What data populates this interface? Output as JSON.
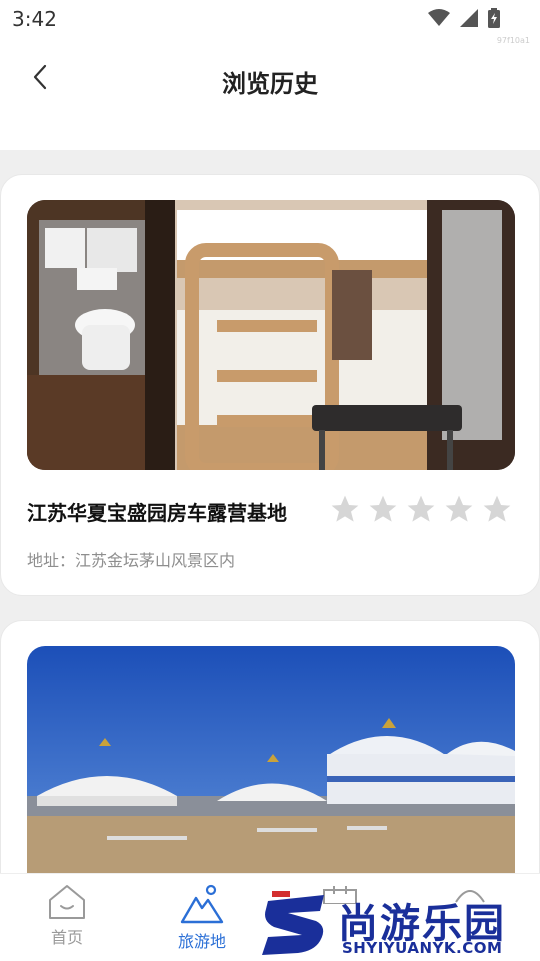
{
  "status_bar": {
    "time": "3:42",
    "watermark_id": "97f10a1"
  },
  "header": {
    "title": "浏览历史"
  },
  "cards": [
    {
      "title": "江苏华夏宝盛园房车露营基地",
      "address": "地址：江苏金坛茅山风景区内",
      "rating": {
        "stars_filled": 0,
        "stars_total": 5
      },
      "image_desc": "rv-interior-bunk-beds-photo"
    },
    {
      "image_desc": "mongolian-yurt-camp-photo"
    }
  ],
  "bottom_nav": {
    "items": [
      {
        "label": "首页",
        "icon": "home-icon",
        "active": false
      },
      {
        "label": "旅游地",
        "icon": "mountain-location-icon",
        "active": true
      },
      {
        "label": "",
        "icon": "calendar-icon",
        "active": false
      },
      {
        "label": "",
        "icon": "profile-icon",
        "active": false
      }
    ]
  },
  "watermark": {
    "name": "尚游乐园",
    "url": "SHYIYUANYK.COM"
  },
  "colors": {
    "accent": "#2b6fd6",
    "inactive": "#9a9a9a",
    "star_empty": "#d6d6d6",
    "brand": "#1a2f9a"
  }
}
